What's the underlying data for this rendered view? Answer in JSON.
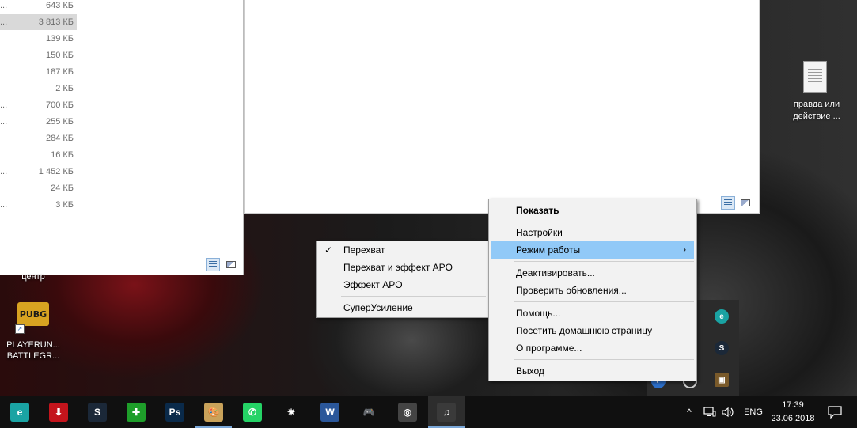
{
  "left_window": {
    "sizes": [
      {
        "value": "643 КБ",
        "dots": true
      },
      {
        "value": "3 813 КБ",
        "dots": true,
        "selected": true
      },
      {
        "value": "139 КБ",
        "dots": false
      },
      {
        "value": "150 КБ",
        "dots": false
      },
      {
        "value": "187 КБ",
        "dots": false
      },
      {
        "value": "2 КБ",
        "dots": false
      },
      {
        "value": "700 КБ",
        "dots": true
      },
      {
        "value": "255 КБ",
        "dots": true
      },
      {
        "value": "284 КБ",
        "dots": false
      },
      {
        "value": "16 КБ",
        "dots": false
      },
      {
        "value": "1 452 КБ",
        "dots": true
      },
      {
        "value": "24 КБ",
        "dots": false
      },
      {
        "value": "3 КБ",
        "dots": true
      }
    ],
    "dots_text": "..."
  },
  "desktop": {
    "center_label": "центр",
    "pubg_label_line1": "PLAYERUN...",
    "pubg_label_line2": "BATTLEGR...",
    "pubg_logo_text": "PUBG",
    "doc_label_line1": "правда или",
    "doc_label_line2": "действие ..."
  },
  "context_menu": {
    "items": [
      {
        "label": "Показать",
        "bold": true
      },
      {
        "label": "Настройки"
      },
      {
        "label": "Режим работы",
        "submenu": true,
        "highlighted": true
      },
      {
        "label": "Деактивировать..."
      },
      {
        "label": "Проверить обновления..."
      },
      {
        "label": "Помощь..."
      },
      {
        "label": "Посетить домашнюю страницу"
      },
      {
        "label": "О программе..."
      },
      {
        "label": "Выход"
      }
    ],
    "submenu_arrow": "›"
  },
  "submenu": {
    "items": [
      {
        "label": "Перехват",
        "checked": true
      },
      {
        "label": "Перехват и эффект APO"
      },
      {
        "label": "Эффект APO"
      },
      {
        "label": "СуперУсиление"
      }
    ],
    "check_glyph": "✓"
  },
  "taskbar": {
    "apps": [
      {
        "name": "edge-like-app-icon",
        "color": "#1aa3a3",
        "glyph": "e"
      },
      {
        "name": "download-app-icon",
        "color": "#c4141c",
        "glyph": "⬇"
      },
      {
        "name": "steam-icon",
        "color": "#1b2838",
        "glyph": "S"
      },
      {
        "name": "green-cross-app-icon",
        "color": "#1e9e2a",
        "glyph": "✚"
      },
      {
        "name": "photoshop-icon",
        "color": "#0a2a4a",
        "glyph": "Ps"
      },
      {
        "name": "paint-palette-icon",
        "color": "#c9a25a",
        "glyph": "🎨"
      },
      {
        "name": "whatsapp-icon",
        "color": "#25d366",
        "glyph": "✆"
      },
      {
        "name": "brightness-app-icon",
        "color": "#101010",
        "glyph": "✷"
      },
      {
        "name": "word-icon",
        "color": "#2b579a",
        "glyph": "W"
      },
      {
        "name": "gamepad-icon",
        "color": "#101010",
        "glyph": "🎮"
      },
      {
        "name": "disc-app-icon",
        "color": "#444444",
        "glyph": "◎"
      },
      {
        "name": "audio-enhancer-icon",
        "color": "#3a3a3a",
        "glyph": "♫"
      }
    ],
    "language": "ENG",
    "time": "17:39",
    "date": "23.06.2018",
    "chevron": "^"
  },
  "tray_flyout": {
    "icons": [
      "eset-icon",
      "steam-tray-icon",
      "package-icon"
    ]
  }
}
